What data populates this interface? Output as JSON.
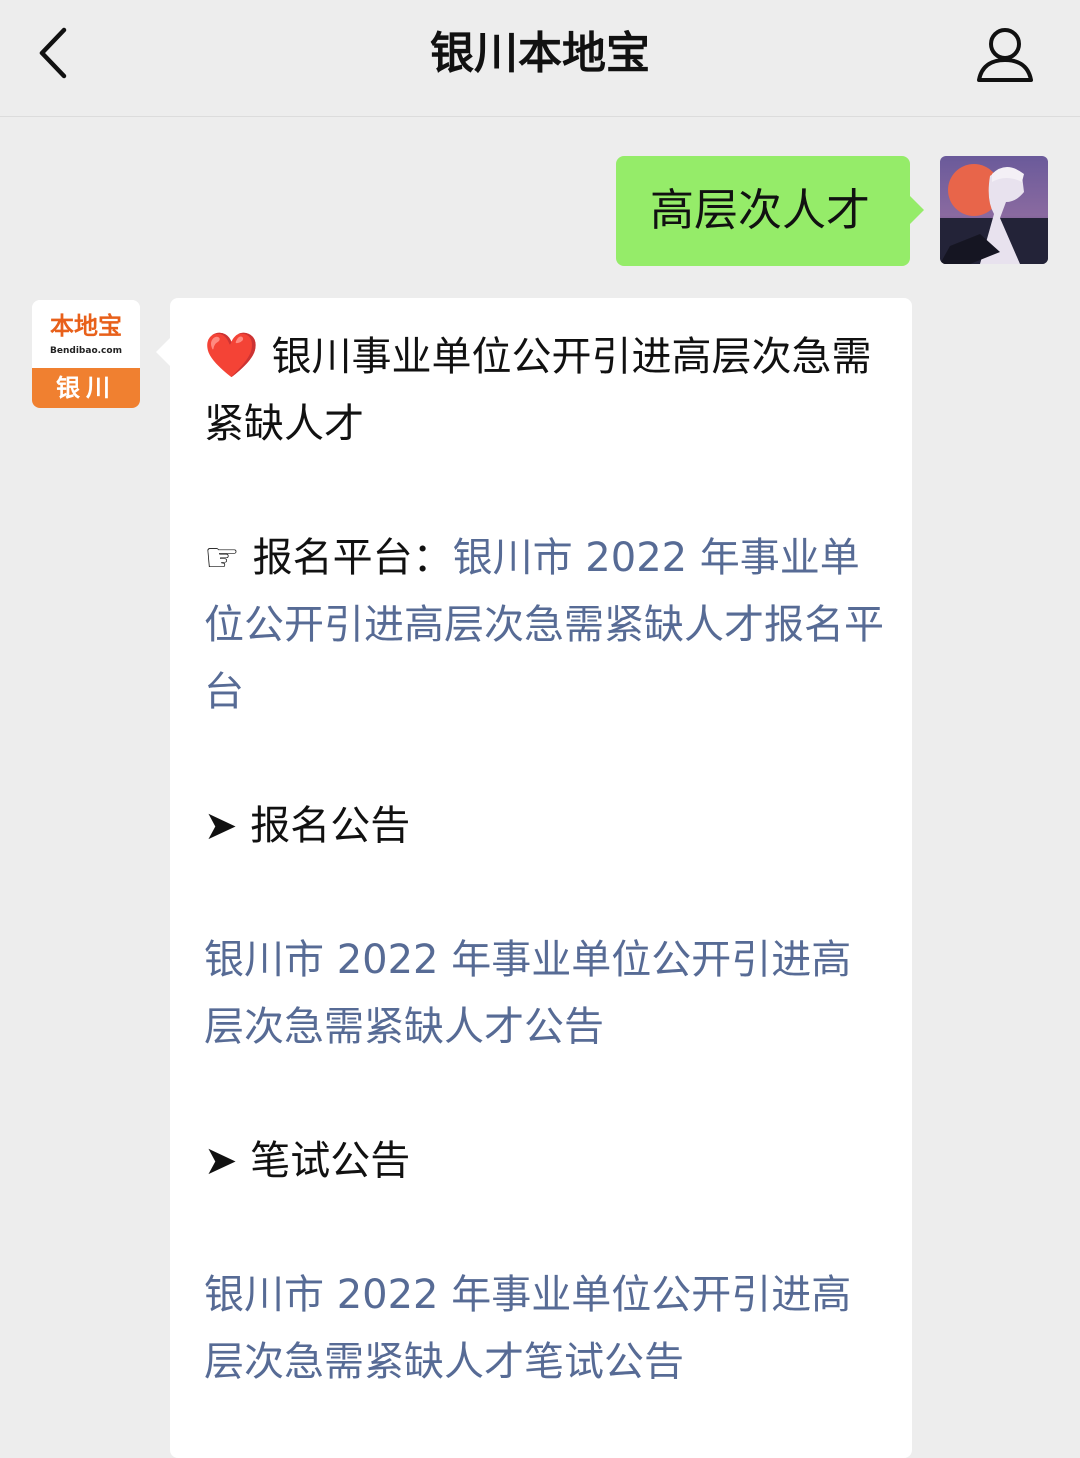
{
  "header": {
    "title": "银川本地宝"
  },
  "icons": {
    "back": "chevron-left-icon",
    "profile": "person-icon"
  },
  "conversation": {
    "outgoing_text": "高层次人才",
    "bot_avatar": {
      "logo_text": "本地宝",
      "logo_domain": "Bendibao.com",
      "city": "银川"
    },
    "reply": {
      "heart": "❤️",
      "heading": "银川事业单位公开引进高层次急需紧缺人才",
      "pointer": "☞",
      "platform_label": "报名平台：",
      "platform_link": "银川市 2022 年事业单位公开引进高层次急需紧缺人才报名平台",
      "arrow1": "➤",
      "section1_title": "报名公告",
      "section1_link": "银川市 2022 年事业单位公开引进高层次急需紧缺人才公告",
      "arrow2": "➤",
      "section2_title": "笔试公告",
      "section2_link": "银川市 2022 年事业单位公开引进高层次急需紧缺人才笔试公告"
    }
  },
  "colors": {
    "background": "#ededed",
    "outgoing_bubble": "#95ec69",
    "incoming_bubble": "#ffffff",
    "link": "#576b95",
    "brand_orange": "#f08030"
  }
}
